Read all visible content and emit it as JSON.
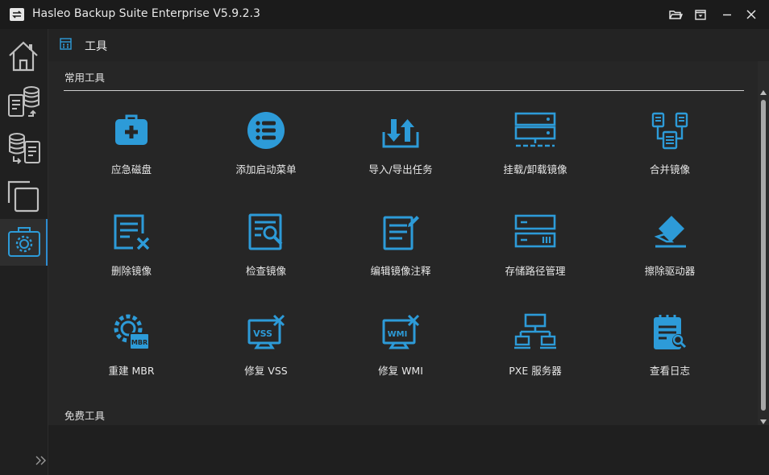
{
  "window": {
    "title": "Hasleo Backup Suite Enterprise V5.9.2.3",
    "logo_icon": "backup-swap-icon",
    "buttons": [
      "folder-open-icon",
      "menu-icon",
      "minimize-icon",
      "close-icon"
    ]
  },
  "sidebar": {
    "items": [
      {
        "icon": "home-icon",
        "active": false
      },
      {
        "icon": "backup-icon",
        "active": false
      },
      {
        "icon": "restore-icon",
        "active": false
      },
      {
        "icon": "clone-icon",
        "active": false
      },
      {
        "icon": "toolbox-icon",
        "active": true
      }
    ],
    "expand_icon": "double-chevron-right-icon"
  },
  "page": {
    "title": "工具",
    "icon": "grid-icon"
  },
  "sections": {
    "common": "常用工具",
    "free": "免费工具"
  },
  "tools": [
    {
      "label": "应急磁盘",
      "icon": "first-aid-kit-icon"
    },
    {
      "label": "添加启动菜单",
      "icon": "list-menu-icon"
    },
    {
      "label": "导入/导出任务",
      "icon": "import-export-icon"
    },
    {
      "label": "挂载/卸载镜像",
      "icon": "mount-drive-icon"
    },
    {
      "label": "合并镜像",
      "icon": "merge-images-icon"
    },
    {
      "label": "删除镜像",
      "icon": "delete-image-icon"
    },
    {
      "label": "检查镜像",
      "icon": "check-image-icon"
    },
    {
      "label": "编辑镜像注释",
      "icon": "edit-comment-icon"
    },
    {
      "label": "存储路径管理",
      "icon": "storage-path-icon"
    },
    {
      "label": "擦除驱动器",
      "icon": "eraser-icon"
    },
    {
      "label": "重建 MBR",
      "icon": "rebuild-mbr-icon"
    },
    {
      "label": "修复 VSS",
      "icon": "repair-vss-icon"
    },
    {
      "label": "修复 WMI",
      "icon": "repair-wmi-icon"
    },
    {
      "label": "PXE 服务器",
      "icon": "pxe-server-icon"
    },
    {
      "label": "查看日志",
      "icon": "view-log-icon"
    }
  ],
  "colors": {
    "accent": "#2d9bd8",
    "background": "#2a2a2a",
    "titlebar": "#1b1b1b"
  }
}
